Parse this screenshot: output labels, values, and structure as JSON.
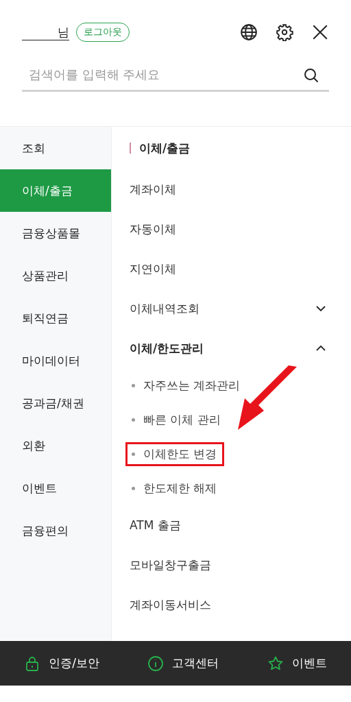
{
  "header": {
    "user_suffix": "님",
    "logout": "로그아웃"
  },
  "search": {
    "placeholder": "검색어를 입력해 주세요"
  },
  "sidebar": {
    "items": [
      {
        "label": "조회",
        "selected": false
      },
      {
        "label": "이체/출금",
        "selected": true
      },
      {
        "label": "금융상품몰",
        "selected": false
      },
      {
        "label": "상품관리",
        "selected": false
      },
      {
        "label": "퇴직연금",
        "selected": false
      },
      {
        "label": "마이데이터",
        "selected": false
      },
      {
        "label": "공과금/채권",
        "selected": false
      },
      {
        "label": "외환",
        "selected": false
      },
      {
        "label": "이벤트",
        "selected": false
      },
      {
        "label": "금융편의",
        "selected": false
      }
    ]
  },
  "menu": {
    "title": "이체/출금",
    "items": [
      {
        "kind": "link",
        "label": "계좌이체"
      },
      {
        "kind": "link",
        "label": "자동이체"
      },
      {
        "kind": "link",
        "label": "지연이체"
      },
      {
        "kind": "group",
        "label": "이체내역조회",
        "expanded": false
      },
      {
        "kind": "group",
        "label": "이체/한도관리",
        "expanded": true,
        "children": [
          {
            "label": "자주쓰는 계좌관리",
            "highlighted": false
          },
          {
            "label": "빠른 이체 관리",
            "highlighted": false
          },
          {
            "label": "이체한도 변경",
            "highlighted": true
          },
          {
            "label": "한도제한 해제",
            "highlighted": false
          }
        ]
      },
      {
        "kind": "link",
        "label": "ATM 출금"
      },
      {
        "kind": "link",
        "label": "모바일창구출금"
      },
      {
        "kind": "link",
        "label": "계좌이동서비스"
      }
    ]
  },
  "bottom_bar": [
    {
      "kind": "lock",
      "label": "인증/보안"
    },
    {
      "kind": "info",
      "label": "고객센터"
    },
    {
      "kind": "star",
      "label": "이벤트"
    }
  ]
}
